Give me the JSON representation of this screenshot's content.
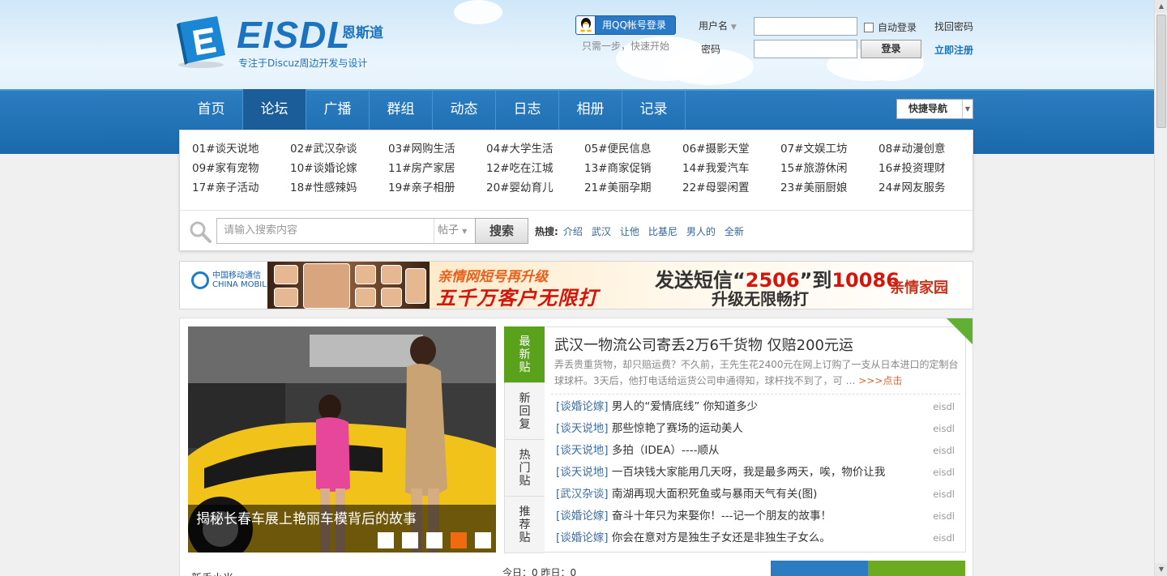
{
  "header": {
    "brand": "EISDL",
    "brand_cn": "恩斯道",
    "slogan": "专注于Discuz周边开发与设计",
    "qq_login_label": "用QQ帐号登录",
    "qq_sub": "只需一步，快速开始",
    "username_label": "用户名",
    "password_label": "密码",
    "auto_login_label": "自动登录",
    "find_password": "找回密码",
    "login_button": "登录",
    "register_link": "立即注册"
  },
  "nav": {
    "items": [
      "首页",
      "论坛",
      "广播",
      "群组",
      "动态",
      "日志",
      "相册",
      "记录"
    ],
    "active_index": 1,
    "quick_nav": "快捷导航"
  },
  "categories": [
    "01#谈天说地",
    "02#武汉杂谈",
    "03#网购生活",
    "04#大学生活",
    "05#便民信息",
    "06#摄影天堂",
    "07#文娱工坊",
    "08#动漫创意",
    "09#家有宠物",
    "10#谈婚论嫁",
    "11#房产家居",
    "12#吃在江城",
    "13#商家促销",
    "14#我爱汽车",
    "15#旅游休闲",
    "16#投资理财",
    "17#亲子活动",
    "18#性感辣妈",
    "19#亲子相册",
    "20#婴幼育儿",
    "21#美丽孕期",
    "22#母婴闲置",
    "23#美丽厨娘",
    "24#网友服务"
  ],
  "search": {
    "placeholder": "请输入搜索内容",
    "type": "帖子",
    "button": "搜索",
    "hot_label": "热搜:",
    "hot_terms": [
      "介绍",
      "武汉",
      "让他",
      "比基尼",
      "男人的",
      "全新"
    ]
  },
  "banner": {
    "carrier": "中国移动通信",
    "carrier_en": "CHINA MOBILE",
    "line1": "亲情网短号再升级",
    "line2": "五千万客户无限打",
    "line3_a": "发送短信“",
    "line3_code": "2506",
    "line3_b": "”到",
    "line3_num": "10086",
    "line4": "升级无限畅打",
    "brand": "亲情家园"
  },
  "slideshow": {
    "caption": "揭秘长春车展上艳丽车模背后的故事",
    "active_dot": 3,
    "dot_count": 5
  },
  "tabs": [
    "最新贴",
    "新回复",
    "热门贴",
    "推荐贴"
  ],
  "headline": {
    "title": "武汉一物流公司寄丢2万6千货物  仅赔200元运",
    "desc": "弄丢贵重货物，却只赔运费？不久前，王先生花2400元在网上订购了一支从日本进口的定制台球球杆。3天后，他打电话给运货公司申通得知，球杆找不到了，可 …",
    "more": ">>>点击"
  },
  "posts": [
    {
      "cat": "[谈婚论嫁]",
      "title": "男人的“爱情底线”  你知道多少",
      "author": "eisdl"
    },
    {
      "cat": "[谈天说地]",
      "title": "那些惊艳了赛场的运动美人",
      "author": "eisdl"
    },
    {
      "cat": "[谈天说地]",
      "title": "多拍（IDEA）----顺从",
      "author": "eisdl"
    },
    {
      "cat": "[谈天说地]",
      "title": "一百块钱大家能用几天呀，我是最多两天，唉，物价让我",
      "author": "eisdl"
    },
    {
      "cat": "[武汉杂谈]",
      "title": "南湖再现大面积死鱼或与暴雨天气有关(图)",
      "author": "eisdl"
    },
    {
      "cat": "[谈婚论嫁]",
      "title": "奋斗十年只为来娶你！---记一个朋友的故事！",
      "author": "eisdl"
    },
    {
      "cat": "[谈婚论嫁]",
      "title": "你会在意对方是独生子女还是非独生子女么。",
      "author": "eisdl"
    }
  ],
  "footer_partial": {
    "new_members": "新手小米",
    "stats": "今日：0  昨日：0"
  },
  "colors": {
    "primary": "#1c73bd",
    "nav": "#2b7cc0",
    "accent_green": "#5aa21c",
    "accent_orange": "#f26a10"
  }
}
